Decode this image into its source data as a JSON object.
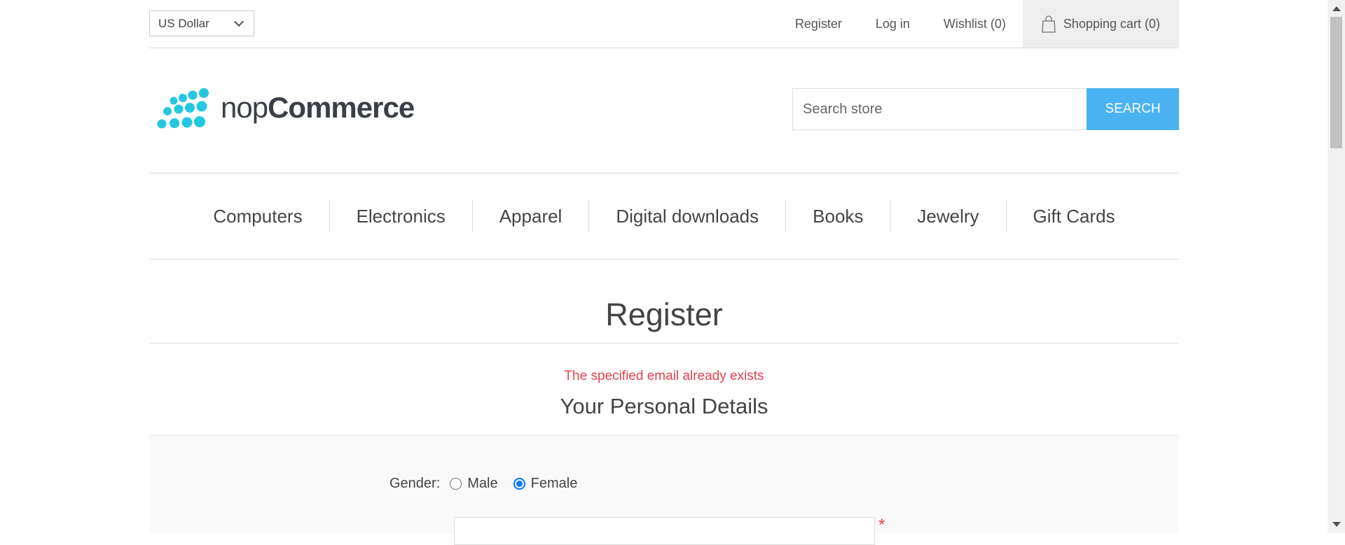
{
  "header": {
    "currency": "US Dollar",
    "links": {
      "register": "Register",
      "login": "Log in",
      "wishlist": "Wishlist (0)",
      "cart": "Shopping cart (0)"
    }
  },
  "logo": {
    "light": "nop",
    "bold": "Commerce"
  },
  "search": {
    "placeholder": "Search store",
    "button_label": "SEARCH"
  },
  "menu": {
    "items": [
      "Computers",
      "Electronics",
      "Apparel",
      "Digital downloads",
      "Books",
      "Jewelry",
      "Gift Cards"
    ]
  },
  "page": {
    "title": "Register",
    "error": "The specified email already exists",
    "section_title": "Your Personal Details"
  },
  "form": {
    "gender_label": "Gender:",
    "male_label": "Male",
    "female_label": "Female",
    "selected_gender": "Female",
    "required_mark": "*"
  },
  "colors": {
    "accent": "#4ab2f1",
    "error": "#e4434b",
    "logo_dots": "#25c7e0"
  }
}
